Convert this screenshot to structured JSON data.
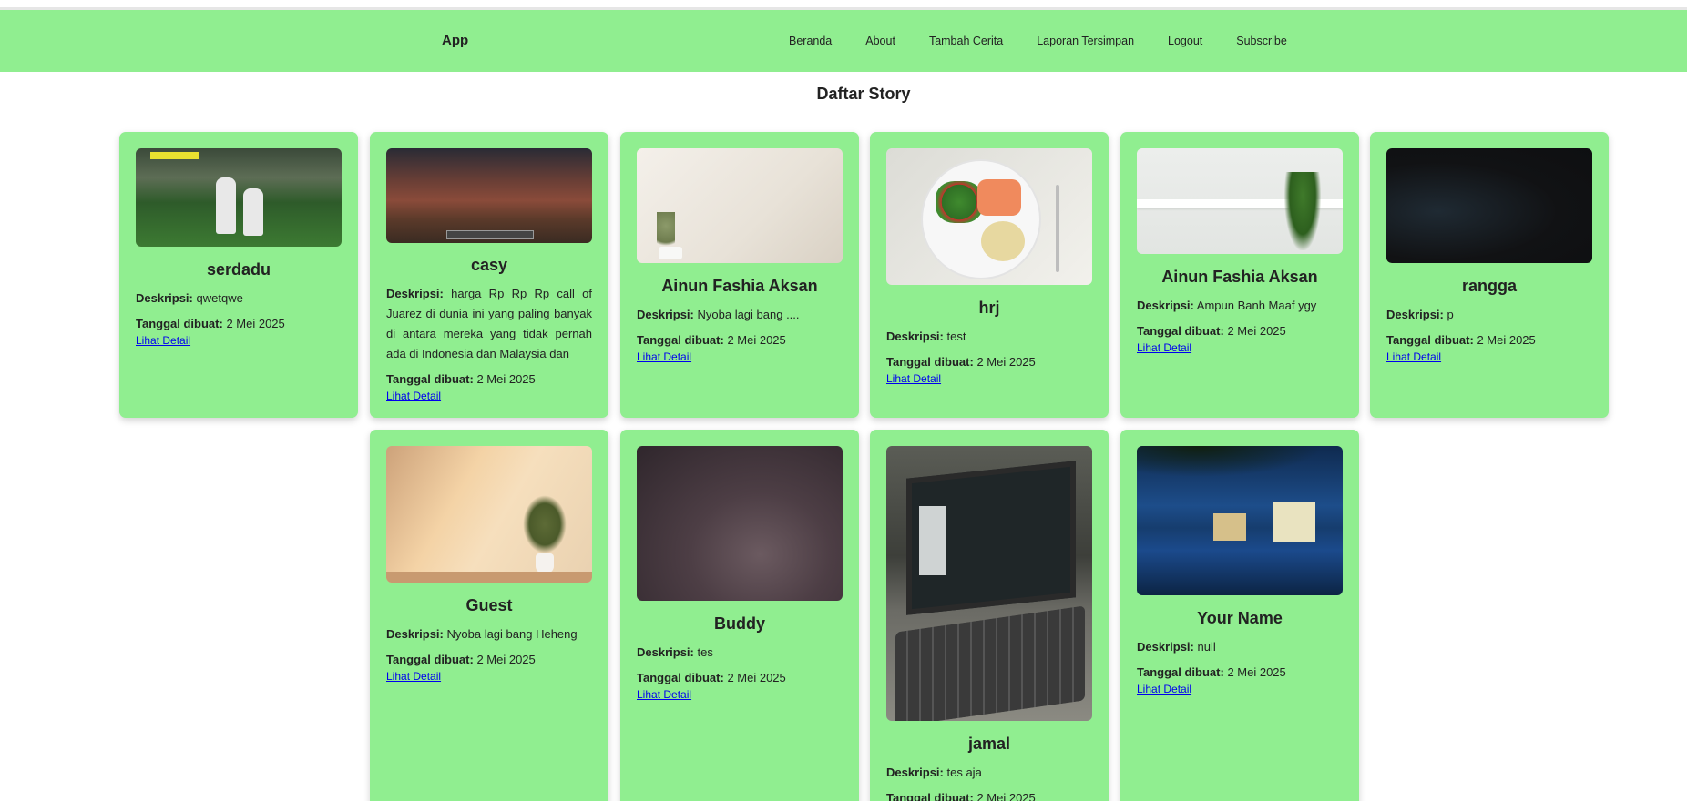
{
  "navbar": {
    "brand": "App",
    "links": [
      "Beranda",
      "About",
      "Tambah Cerita",
      "Laporan Tersimpan",
      "Logout",
      "Subscribe"
    ]
  },
  "page_title": "Daftar Story",
  "labels": {
    "desc_label": "Deskripsi:",
    "date_label": "Tanggal dibuat:",
    "detail_link": "Lihat Detail"
  },
  "stories": [
    {
      "name": "serdadu",
      "description": "qwetqwe",
      "date": "2 Mei 2025",
      "image": "soccer-game-screenshot"
    },
    {
      "name": "casy",
      "description": "harga Rp Rp Rp call of Juarez di dunia ini yang paling banyak di antara mereka yang tidak pernah ada di Indonesia dan Malaysia dan",
      "date": "2 Mei 2025",
      "image": "minecraft-sunset-screenshot"
    },
    {
      "name": "Ainun Fashia Aksan",
      "description": "Nyoba lagi bang ....",
      "date": "2 Mei 2025",
      "image": "plant-against-wall"
    },
    {
      "name": "hrj",
      "description": "test",
      "date": "2 Mei 2025",
      "image": "salmon-salad-plate"
    },
    {
      "name": "Ainun Fashia Aksan",
      "description": "Ampun Banh Maaf ygy",
      "date": "2 Mei 2025",
      "image": "wall-shelf-ivy"
    },
    {
      "name": "rangga",
      "description": "p",
      "date": "2 Mei 2025",
      "image": "dark-photo"
    },
    {
      "name": "Guest",
      "description": "Nyoba lagi bang Heheng",
      "date": "2 Mei 2025",
      "image": "sunlit-plant-vase"
    },
    {
      "name": "Buddy",
      "description": "tes",
      "date": "2 Mei 2025",
      "image": "dark-fabric"
    },
    {
      "name": "jamal",
      "description": "tes aja",
      "date": "2 Mei 2025",
      "image": "laptop-on-desk"
    },
    {
      "name": "Your Name",
      "description": "null",
      "date": "2 Mei 2025",
      "image": "lake-night-buildings"
    }
  ]
}
